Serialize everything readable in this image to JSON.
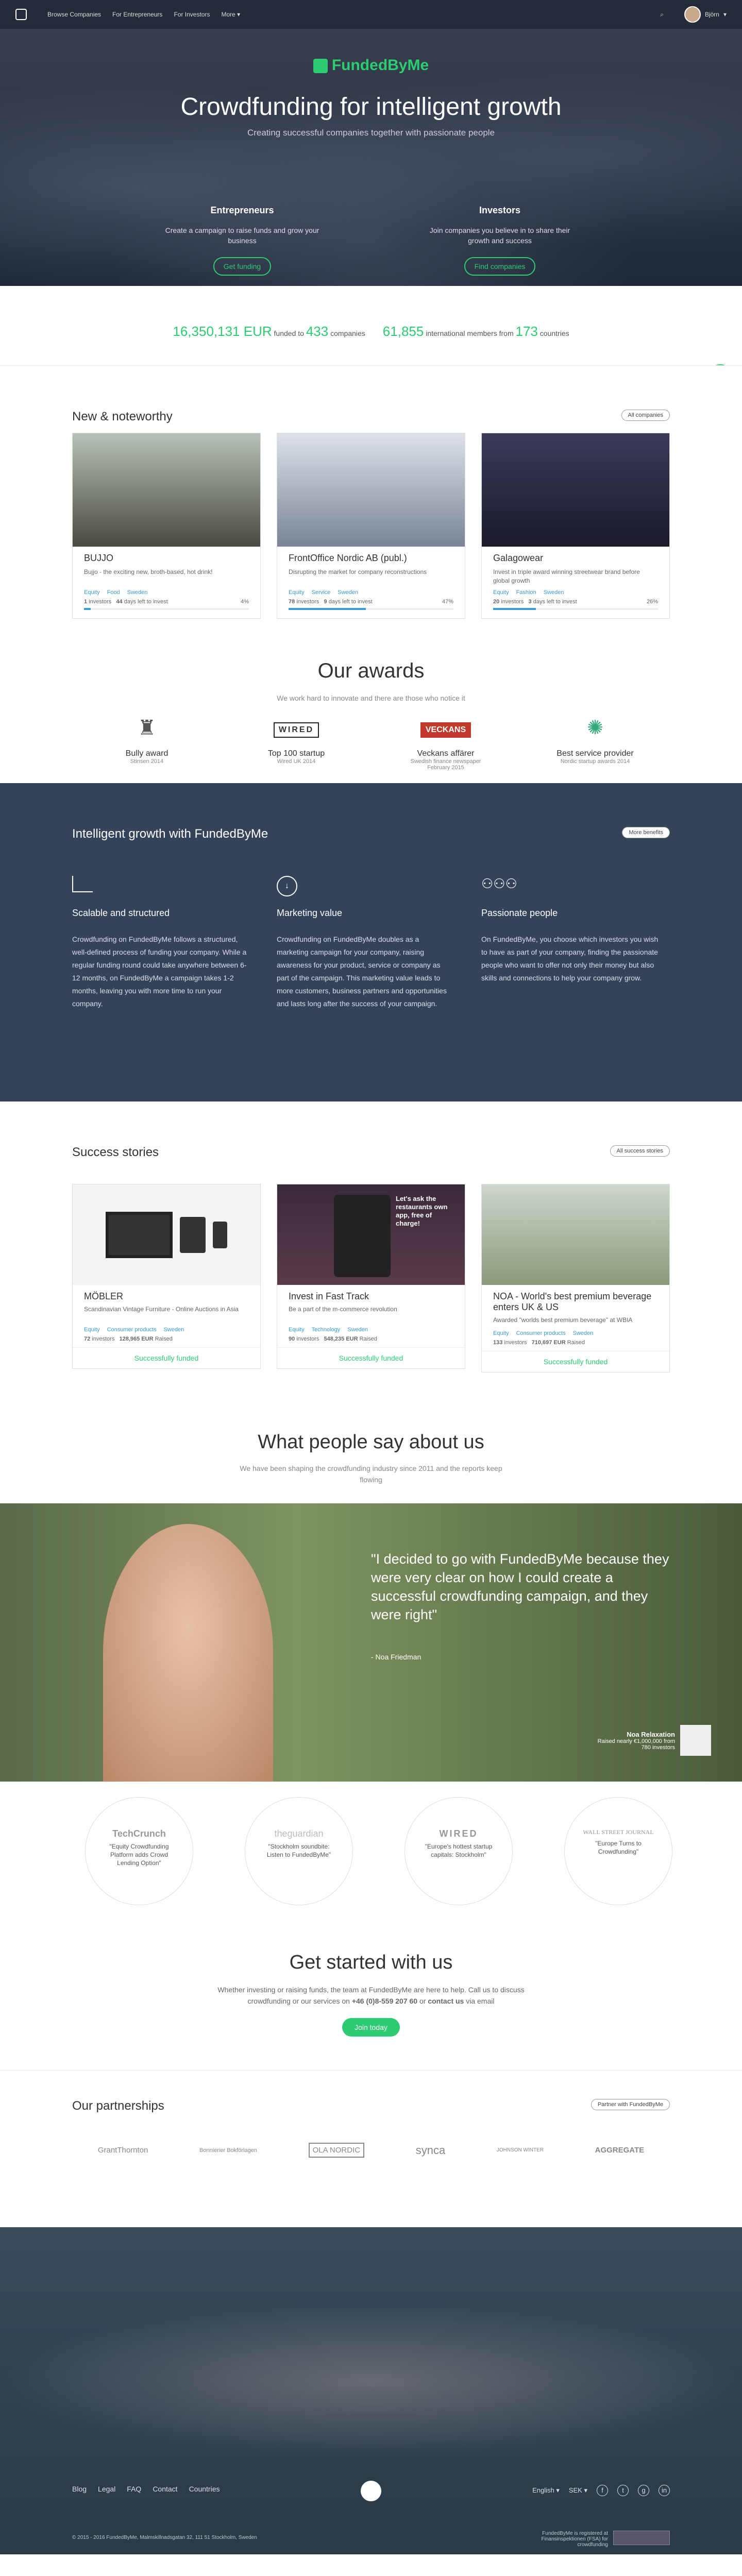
{
  "nav": {
    "items": [
      "Browse Companies",
      "For Entrepreneurs",
      "For Investors",
      "More"
    ],
    "user": "Björn"
  },
  "hero": {
    "brand": "FundedByMe",
    "title": "Crowdfunding for intelligent growth",
    "subtitle": "Creating successful companies together with passionate people",
    "entrepreneurs": {
      "title": "Entrepreneurs",
      "text": "Create a campaign to raise funds and grow your business",
      "button": "Get funding"
    },
    "investors": {
      "title": "Investors",
      "text": "Join companies you believe in to share their growth and success",
      "button": "Find companies"
    }
  },
  "stats": {
    "funded_amount": "16,350,131 EUR",
    "funded_label": "funded to",
    "companies_count": "433",
    "companies_label": "companies",
    "members_count": "61,855",
    "members_label": "international members from",
    "countries_count": "173",
    "countries_label": "countries"
  },
  "news": {
    "title": "New & noteworthy",
    "all_button": "All companies",
    "cards": [
      {
        "name": "BUJJO",
        "desc": "Bujjo - the exciting new, broth-based, hot drink!",
        "tags": [
          "Equity",
          "Food",
          "Sweden"
        ],
        "investors": "1",
        "investors_label": "investors",
        "days": "44",
        "days_label": "days left to invest",
        "percent": "4%",
        "progress": 4
      },
      {
        "name": "FrontOffice Nordic AB (publ.)",
        "desc": "Disrupting the market for company reconstructions",
        "tags": [
          "Equity",
          "Service",
          "Sweden"
        ],
        "investors": "78",
        "investors_label": "investors",
        "days": "9",
        "days_label": "days left to invest",
        "percent": "47%",
        "progress": 47
      },
      {
        "name": "Galagowear",
        "desc": "Invest in triple award winning streetwear brand before global growth",
        "tags": [
          "Equity",
          "Fashion",
          "Sweden"
        ],
        "investors": "20",
        "investors_label": "investors",
        "days": "3",
        "days_label": "days left to invest",
        "percent": "26%",
        "progress": 26
      }
    ]
  },
  "awards": {
    "title": "Our awards",
    "subtitle": "We work hard to innovate and there are those who notice it",
    "items": [
      {
        "name": "Bully award",
        "source": "Stinsen 2014"
      },
      {
        "name": "Top 100 startup",
        "source": "Wired UK 2014"
      },
      {
        "name": "Veckans affärer",
        "source": "Swedish finance newspaper February 2015"
      },
      {
        "name": "Best service provider",
        "source": "Nordic startup awards 2014"
      }
    ],
    "logos": [
      "WIRED",
      "VECKANS"
    ]
  },
  "intelligent": {
    "title": "Intelligent growth with FundedByMe",
    "button": "More benefits",
    "cols": [
      {
        "title": "Scalable and structured",
        "text": "Crowdfunding on FundedByMe follows a structured, well-defined process of funding your company. While a regular funding round could take anywhere between 6-12 months, on FundedByMe a campaign takes 1-2 months, leaving you with more time to run your company."
      },
      {
        "title": "Marketing value",
        "text": "Crowdfunding on FundedByMe doubles as a marketing campaign for your company, raising awareness for your product, service or company as part of the campaign. This marketing value leads to more customers, business partners and opportunities and lasts long after the success of your campaign."
      },
      {
        "title": "Passionate people",
        "text": "On FundedByMe, you choose which investors you wish to have as part of your company, finding the passionate people who want to offer not only their money but also skills and connections to help your company grow."
      }
    ]
  },
  "success": {
    "title": "Success stories",
    "button": "All success stories",
    "funded_label": "Successfully funded",
    "cards": [
      {
        "name": "MÖBLER",
        "desc": "Scandinavian Vintage Furniture - Online Auctions in Asia",
        "tags": [
          "Equity",
          "Consumer products",
          "Sweden"
        ],
        "investors": "72",
        "raised": "128,965 EUR",
        "raised_label": "Raised"
      },
      {
        "name": "Invest in Fast Track",
        "desc": "Be a part of the m-commerce revolution",
        "tags": [
          "Equity",
          "Technology",
          "Sweden"
        ],
        "investors": "90",
        "raised": "548,235 EUR",
        "raised_label": "Raised"
      },
      {
        "name": "NOA - World's best premium beverage enters UK & US",
        "desc": "Awarded \"worlds best premium beverage\" at WBIA",
        "tags": [
          "Equity",
          "Consumer products",
          "Sweden"
        ],
        "investors": "133",
        "raised": "710,697 EUR",
        "raised_label": "Raised"
      }
    ],
    "phone_text": "Let's ask the restaurants own app, free of charge!"
  },
  "people": {
    "title": "What people say about us",
    "subtitle": "We have been shaping the crowdfunding industry since 2011 and the reports keep flowing"
  },
  "testimonial": {
    "quote": "\"I decided to go with FundedByMe because they were very clear on how I could create a successful crowdfunding campaign, and they were right\"",
    "author": "- Noa Friedman",
    "badge_title": "Noa Relaxation",
    "badge_text": "Raised nearly €1,000,000 from 780 investors"
  },
  "press": [
    {
      "logo": "TechCrunch",
      "quote": "\"Equity Crowdfunding Platform adds Crowd Lending Option\""
    },
    {
      "logo": "theguardian",
      "quote": "\"Stockholm soundbite: Listen to FundedByMe\""
    },
    {
      "logo": "WIRED",
      "quote": "\"Europe's hottest startup capitals: Stockholm\""
    },
    {
      "logo": "WALL STREET JOURNAL",
      "quote": "\"Europe Turns to Crowdfunding\""
    }
  ],
  "start": {
    "title": "Get started with us",
    "text": "Whether investing or raising funds, the team at FundedByMe are here to help. Call us to discuss crowdfunding or our services on",
    "phone": "+46 (0)8-559 207 60",
    "or": "or",
    "contact": "contact us",
    "via": "via email",
    "button": "Join today"
  },
  "partners": {
    "title": "Our partnerships",
    "button": "Partner with FundedByMe",
    "logos": [
      "GrantThornton",
      "Bonnierier Bokförlagen",
      "OLA NORDIC",
      "synca",
      "JOHNSON WINTER",
      "AGGREGATE"
    ]
  },
  "footer": {
    "links": [
      "Blog",
      "Legal",
      "FAQ",
      "Contact",
      "Countries"
    ],
    "language": "English",
    "currency": "SEK",
    "copyright": "© 2015 - 2016 FundedByMe, Malmskillnadsgatan 32, 111 51 Stockholm, Sweden",
    "regulated": "FundedByMe is registered at Finansinspektionen (FSA) for crowdfunding"
  }
}
